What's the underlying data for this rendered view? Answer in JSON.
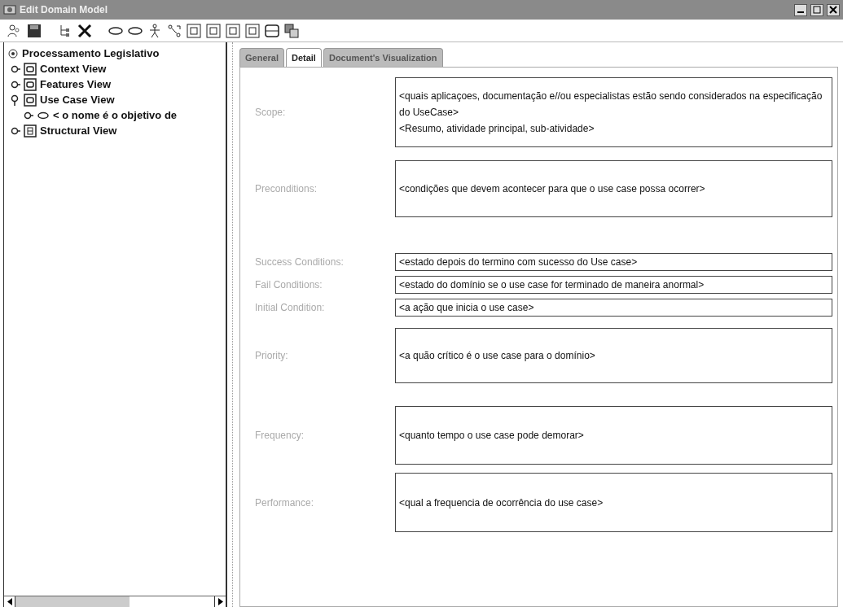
{
  "window": {
    "title": "Edit Domain Model"
  },
  "toolbar": [
    {
      "kind": "users"
    },
    {
      "kind": "save"
    },
    {
      "kind": "tree"
    },
    {
      "kind": "delete"
    },
    {
      "kind": "ellipse"
    },
    {
      "kind": "ellipse"
    },
    {
      "kind": "actor"
    },
    {
      "kind": "relation"
    },
    {
      "kind": "boxC"
    },
    {
      "kind": "boxF"
    },
    {
      "kind": "boxS"
    },
    {
      "kind": "boxE"
    },
    {
      "kind": "table"
    },
    {
      "kind": "copy"
    }
  ],
  "tree": {
    "label": "Processamento Legislativo",
    "children": [
      {
        "label": "Context View",
        "expanded": false,
        "kind": "view"
      },
      {
        "label": "Features View",
        "expanded": false,
        "kind": "view"
      },
      {
        "label": "Use Case View",
        "expanded": true,
        "kind": "view",
        "children": [
          {
            "label": "< o nome é o objetivo de",
            "expanded": false,
            "kind": "usecase"
          }
        ]
      },
      {
        "label": "Structural View",
        "expanded": false,
        "kind": "structural"
      }
    ]
  },
  "tabs": [
    {
      "label": "General",
      "selected": false
    },
    {
      "label": "Detail",
      "selected": true
    },
    {
      "label": "Document's Visualization",
      "selected": false
    }
  ],
  "fields": [
    {
      "label": "Scope:",
      "kind": "area",
      "value": "<quais aplicaçoes, documentação e//ou especialistas estão sendo considerados na especificação do UseCase>\n<Resumo, atividade principal, sub-atividade>"
    },
    {
      "label": "Preconditions:",
      "kind": "area",
      "value": "<condições que devem acontecer para que o use case possa ocorrer>"
    },
    {
      "label": "Success Conditions:",
      "kind": "line",
      "value": "<estado depois do termino com sucesso do Use case>"
    },
    {
      "label": "Fail Conditions:",
      "kind": "line",
      "value": "<estado do domínio se o use case for terminado de maneira anormal>"
    },
    {
      "label": "Initial Condition:",
      "kind": "line",
      "value": "<a ação que inicia o use case>"
    },
    {
      "label": "Priority:",
      "kind": "area",
      "value": "<a quão crítico é o use case para o domínio>"
    },
    {
      "label": "Frequency:",
      "kind": "area",
      "value": "<quanto tempo o use case pode demorar>"
    },
    {
      "label": "Performance:",
      "kind": "area",
      "value": "<qual a frequencia de ocorrência do use case>"
    }
  ]
}
